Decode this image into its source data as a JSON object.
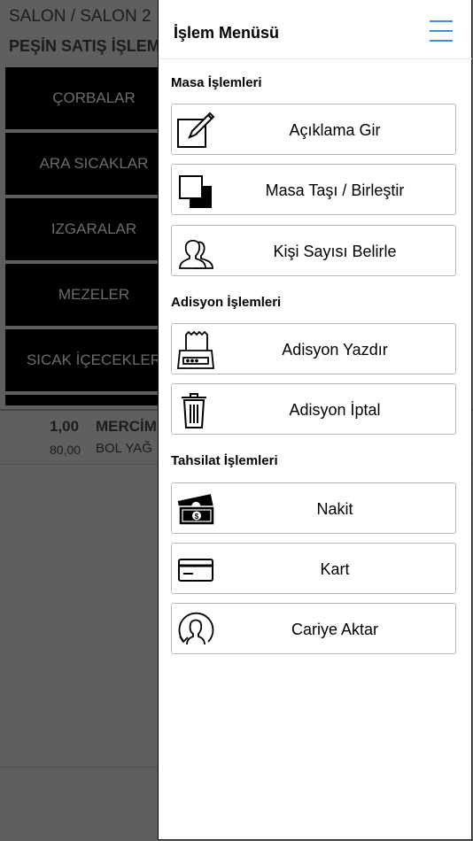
{
  "background": {
    "breadcrumb": "SALON / SALON 2",
    "subtitle": "PEŞİN SATIŞ İŞLEM",
    "categories": [
      {
        "label": "ÇORBALAR"
      },
      {
        "label": "ARA SICAKLAR"
      },
      {
        "label": "IZGARALAR"
      },
      {
        "label": "MEZELER"
      },
      {
        "label": "SICAK İÇECEKLER"
      }
    ],
    "order": {
      "quantity": "1,00",
      "name": "MERCİM",
      "price": "80,00",
      "note": "BOL YAĞ"
    }
  },
  "drawer": {
    "title": "İşlem Menüsü",
    "menu_icon": "hamburger-menu-icon",
    "accent_color": "#3a8fe0",
    "sections": [
      {
        "heading": "Masa İşlemleri",
        "items": [
          {
            "label": "Açıklama Gir",
            "icon": "edit-note-icon"
          },
          {
            "label": "Masa Taşı / Birleştir",
            "icon": "move-merge-table-icon"
          },
          {
            "label": "Kişi Sayısı Belirle",
            "icon": "people-icon"
          }
        ]
      },
      {
        "heading": "Adisyon İşlemleri",
        "items": [
          {
            "label": "Adisyon Yazdır",
            "icon": "receipt-printer-icon"
          },
          {
            "label": "Adisyon İptal",
            "icon": "trash-icon"
          }
        ]
      },
      {
        "heading": "Tahsilat İşlemleri",
        "items": [
          {
            "label": "Nakit",
            "icon": "cash-icon"
          },
          {
            "label": "Kart",
            "icon": "credit-card-icon"
          },
          {
            "label": "Cariye Aktar",
            "icon": "customer-transfer-icon"
          }
        ]
      }
    ]
  }
}
